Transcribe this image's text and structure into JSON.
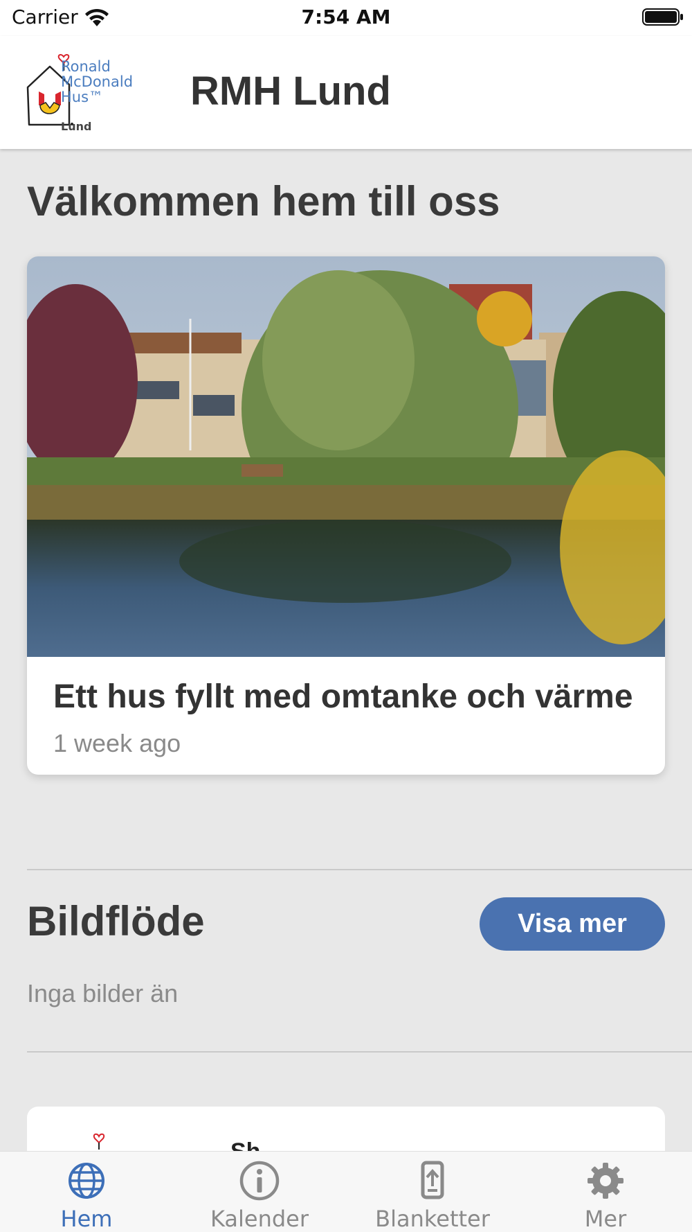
{
  "status_bar": {
    "carrier": "Carrier",
    "time": "7:54 AM",
    "icons": [
      "wifi-icon",
      "battery-icon"
    ]
  },
  "header": {
    "logo": {
      "line1": "Ronald",
      "line2": "McDonald",
      "line3": "Hus™",
      "line4": "Lund"
    },
    "title": "RMH Lund"
  },
  "welcome": {
    "title": "Välkommen hem till oss",
    "card": {
      "image_icon": "house-garden-photo",
      "title": "Ett hus fyllt med omtanke och värme",
      "time": "1 week ago"
    }
  },
  "gallery": {
    "title": "Bildflöde",
    "button_label": "Visa mer",
    "empty_text": "Inga bilder än"
  },
  "next_card": {
    "peek_text": "Sh"
  },
  "tabs": [
    {
      "label": "Hem",
      "icon": "globe-icon",
      "active": true
    },
    {
      "label": "Kalender",
      "icon": "info-icon",
      "active": false
    },
    {
      "label": "Blanketter",
      "icon": "upload-document-icon",
      "active": false
    },
    {
      "label": "Mer",
      "icon": "gear-icon",
      "active": false
    }
  ],
  "colors": {
    "accent": "#4a72b0",
    "tab_active": "#3d6fb8",
    "background": "#e8e8e8",
    "muted_text": "#8a8a8a"
  }
}
